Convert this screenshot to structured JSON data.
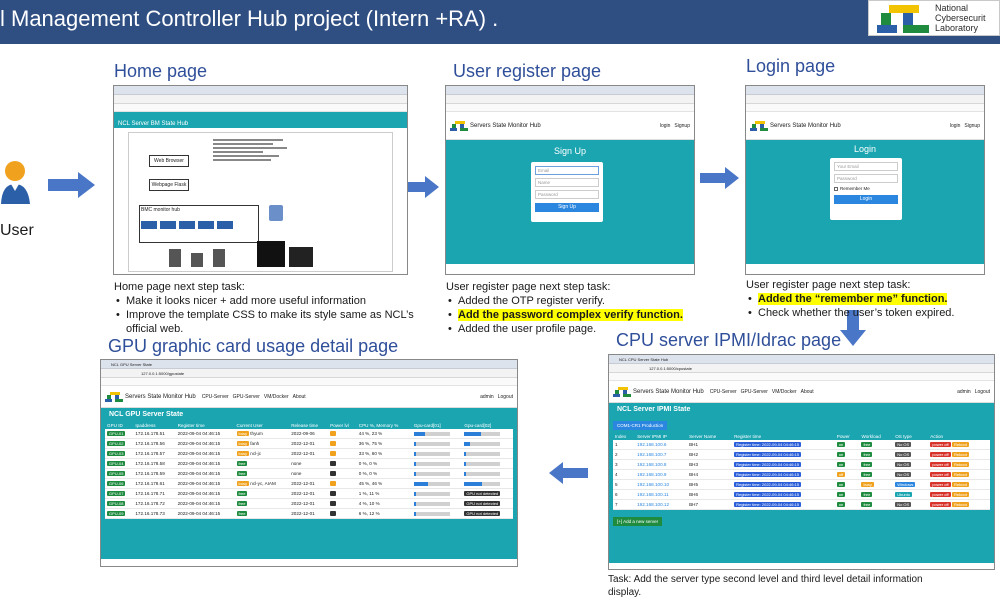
{
  "header": {
    "title": "l Management Controller Hub project (Intern +RA) .",
    "logo_lines": [
      "National",
      "Cybersecurit",
      "Laboratory"
    ]
  },
  "user": {
    "label": "User"
  },
  "home": {
    "title": "Home page",
    "app_title": "NCL Server BM State Hub",
    "diagram_boxes": [
      "Web Browser",
      "Webpage Flask",
      "BMC monitor hub"
    ],
    "notes_heading": "Home page next step task:",
    "notes": [
      "Make it looks nicer + add more useful information",
      "Improve the template CSS to make its style same as NCL’s official web."
    ]
  },
  "register": {
    "title": "User register page",
    "app_brand": "Servers State Monitor Hub",
    "nav_links": [
      "login",
      "Signup"
    ],
    "form_title": "Sign Up",
    "fields": [
      "Email",
      "Name",
      "Password"
    ],
    "button": "Sign Up",
    "notes_heading": "User register page next step task:",
    "notes": [
      "Added the OTP register verify.",
      "Add the password complex verify function.",
      "Added the user profile page."
    ]
  },
  "login": {
    "title": "Login page",
    "app_brand": "Servers State Monitor Hub",
    "nav_links": [
      "login",
      "Signup"
    ],
    "form_title": "Login",
    "fields": [
      "Your Email",
      "Password"
    ],
    "remember": "Remember Me",
    "button": "Login",
    "notes_heading": "User register page next step task:",
    "notes": [
      "Added the “remember me” function.",
      "Check whether the user’s token expired."
    ]
  },
  "gpu": {
    "title": "GPU graphic card usage detail page",
    "tab_title": "NCL GPU Server State",
    "url": "127.0.0.1:5000/gpustate",
    "app_brand": "Servers State Monitor Hub",
    "nav": [
      "CPU-Server",
      "GPU-Server",
      "VM/Docker",
      "About"
    ],
    "user_links": [
      "admin",
      "Logout"
    ],
    "panel_title": "NCL GPU Server State",
    "columns": [
      "GPU ID",
      "Ipaddress",
      "Register time",
      "Current User",
      "Release time",
      "Power lvl",
      "CPU %, Memory %",
      "Gpu-card[01]",
      "Gpu-card[02]"
    ],
    "rows": [
      {
        "id": "GPU-01",
        "ip": "172.16.178.51",
        "reg": "2022-09-04 04:46:15",
        "user": "thyum",
        "rel": "2022-09-06",
        "cpu": "44 %, 23 %",
        "g1": 0.3,
        "g2": 0.45
      },
      {
        "id": "GPU-02",
        "ip": "172.16.178.56",
        "reg": "2022-09-04 04:46:15",
        "user": "fanh",
        "rel": "2022-12-01",
        "cpu": "36 %, 75 %",
        "g1": 0.05,
        "g2": 0.15
      },
      {
        "id": "GPU-03",
        "ip": "172.16.178.57",
        "reg": "2022-09-04 04:46:15",
        "user": "ncl-jc",
        "rel": "2022-12-01",
        "cpu": "33 %, 60 %",
        "g1": 0.05,
        "g2": 0.05
      },
      {
        "id": "GPU-04",
        "ip": "172.16.178.58",
        "reg": "2022-09-04 04:46:15",
        "user": "",
        "rel": "none",
        "cpu": "0 %, 0 %",
        "g1": 0.05,
        "g2": 0.05
      },
      {
        "id": "GPU-05",
        "ip": "172.16.178.59",
        "reg": "2022-09-04 04:46:15",
        "user": "",
        "rel": "none",
        "cpu": "0 %, 0 %",
        "g1": 0.05,
        "g2": 0.05
      },
      {
        "id": "GPU-06",
        "ip": "172.16.178.61",
        "reg": "2022-09-04 04:46:15",
        "user": "ncl-yc, AIAM",
        "rel": "2022-12-01",
        "cpu": "45 %, 46 %",
        "g1": 0.4,
        "g2": 0.5
      },
      {
        "id": "GPU-07",
        "ip": "172.16.178.71",
        "reg": "2022-09-04 04:46:15",
        "user": "",
        "rel": "2022-12-01",
        "cpu": "1 %, 11 %",
        "g1": 0.05,
        "g2": 0.0
      },
      {
        "id": "GPU-08",
        "ip": "172.16.178.72",
        "reg": "2022-09-04 04:46:15",
        "user": "",
        "rel": "2022-12-01",
        "cpu": "4 %, 10 %",
        "g1": 0.05,
        "g2": 0.0
      },
      {
        "id": "GPU-09",
        "ip": "172.16.178.73",
        "reg": "2022-09-04 04:46:15",
        "user": "",
        "rel": "2022-12-01",
        "cpu": "6 %, 12 %",
        "g1": 0.05,
        "g2": 0.0
      }
    ]
  },
  "cpu": {
    "title": "CPU server IPMI/Idrac page",
    "tab_title": "NCL CPU Server State Hub",
    "url": "127.0.0.1:5000/cpustate",
    "app_brand": "Servers State Monitor Hub",
    "nav": [
      "CPU-Server",
      "GPU-Server",
      "VM/Docker",
      "About"
    ],
    "user_links": [
      "admin",
      "Logout"
    ],
    "panel_title": "NCL Server IPMI State",
    "tab_active": "COM1-CR1 Production",
    "columns": [
      "Index",
      "Server IPMI IP",
      "Server Name",
      "Register time",
      "Power",
      "Workload",
      "OS type",
      "Action"
    ],
    "rows": [
      {
        "idx": "1",
        "ip": "192.168.100.6",
        "name": "BH1",
        "power": "on",
        "work": "free",
        "os": "No OS"
      },
      {
        "idx": "2",
        "ip": "192.168.100.7",
        "name": "BH2",
        "power": "on",
        "work": "free",
        "os": "No OS"
      },
      {
        "idx": "3",
        "ip": "192.168.100.8",
        "name": "BH3",
        "power": "on",
        "work": "free",
        "os": "No OS"
      },
      {
        "idx": "4",
        "ip": "192.168.100.9",
        "name": "BH4",
        "power": "off",
        "work": "free",
        "os": "No OS"
      },
      {
        "idx": "5",
        "ip": "192.168.100.10",
        "name": "BH5",
        "power": "on",
        "work": "busy",
        "os": "Windows"
      },
      {
        "idx": "6",
        "ip": "192.168.100.11",
        "name": "BH6",
        "power": "on",
        "work": "free",
        "os": "Ubuntu"
      },
      {
        "idx": "7",
        "ip": "192.168.100.12",
        "name": "BH7",
        "power": "on",
        "work": "free",
        "os": "No OS"
      }
    ],
    "reg_badge": "Register time: 2022-09-04 04:46:15",
    "add_button": "[+] Add a new server",
    "notes": "Task: Add the server type second level and third level detail information display."
  },
  "colors": {
    "banner": "#2f4f83",
    "accent": "#1ba5b1",
    "section_title": "#2f4f9a",
    "arrow": "#4a76c8",
    "highlight": "#ffff00"
  }
}
